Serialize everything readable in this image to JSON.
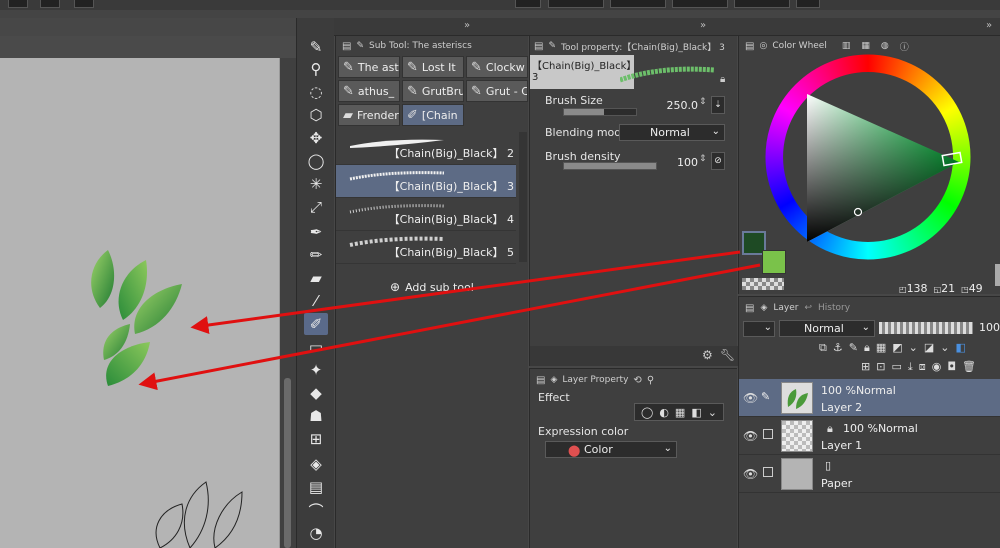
{
  "subtool": {
    "title": "Sub Tool: The asteriscs",
    "buttons": [
      "The ast",
      "Lost It",
      "Clockw",
      "athus_",
      "GrutBru",
      "Grut - C",
      "Frender",
      "[Chain"
    ],
    "brushes": [
      "【Chain(Big)_Black】 2",
      "【Chain(Big)_Black】 3",
      "【Chain(Big)_Black】 4",
      "【Chain(Big)_Black】 5"
    ],
    "add_label": "Add sub tool"
  },
  "toolprop": {
    "title": "Tool property:【Chain(Big)_Black】 3",
    "preview_name": "【Chain(Big)_Black】 3",
    "brush_size_label": "Brush Size",
    "brush_size_value": "250.0",
    "brush_size_level": 0.55,
    "blending_label": "Blending mode",
    "blending_value": "Normal",
    "density_label": "Brush density",
    "density_value": "100",
    "density_level": 1.0
  },
  "layerprop": {
    "title": "Layer Property",
    "effect_label": "Effect",
    "expression_label": "Expression color",
    "expression_value": "Color"
  },
  "colorwheel": {
    "title": "Color Wheel",
    "main_color": "#1e4a24",
    "sub_color": "#7ac24a",
    "readout": [
      "138",
      "21",
      "49"
    ]
  },
  "layers": {
    "tab_layer": "Layer",
    "tab_history": "History",
    "blend_mode": "Normal",
    "opacity": "100",
    "rows": [
      {
        "mode": "100 %Normal",
        "name": "Layer 2"
      },
      {
        "mode": "100 %Normal",
        "name": "Layer 1"
      },
      {
        "mode": "",
        "name": "Paper"
      }
    ]
  },
  "colors": {
    "arrow": "#e01010",
    "accent_selected": "#5d6b85"
  }
}
